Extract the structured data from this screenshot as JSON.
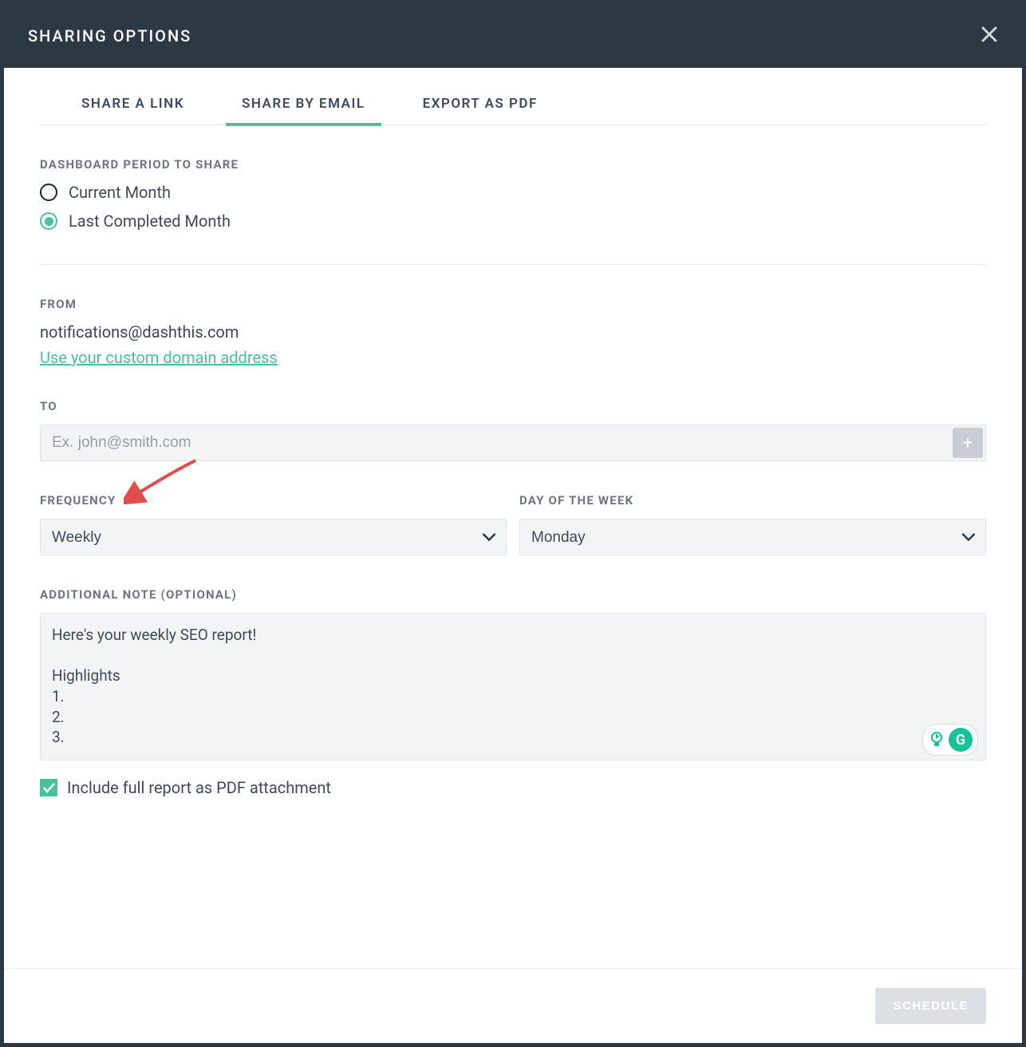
{
  "header": {
    "title": "SHARING OPTIONS"
  },
  "tabs": {
    "link": "SHARE A LINK",
    "email": "SHARE BY EMAIL",
    "pdf": "EXPORT AS PDF",
    "active": "email"
  },
  "period": {
    "label": "DASHBOARD PERIOD TO SHARE",
    "options": {
      "current": "Current Month",
      "last": "Last Completed Month"
    },
    "selected": "last"
  },
  "from": {
    "label": "FROM",
    "email": "notifications@dashthis.com",
    "custom_link": "Use your custom domain address"
  },
  "to": {
    "label": "TO",
    "placeholder": "Ex. john@smith.com",
    "value": ""
  },
  "frequency": {
    "label": "FREQUENCY",
    "value": "Weekly"
  },
  "day": {
    "label": "DAY OF THE WEEK",
    "value": "Monday"
  },
  "note": {
    "label": "ADDITIONAL NOTE (OPTIONAL)",
    "value": "Here's your weekly SEO report!\n\nHighlights\n1.\n2.\n3."
  },
  "pdf_attach": {
    "label": "Include full report as PDF attachment",
    "checked": true
  },
  "footer": {
    "schedule": "SCHEDULE"
  },
  "grammarly_letter": "G"
}
